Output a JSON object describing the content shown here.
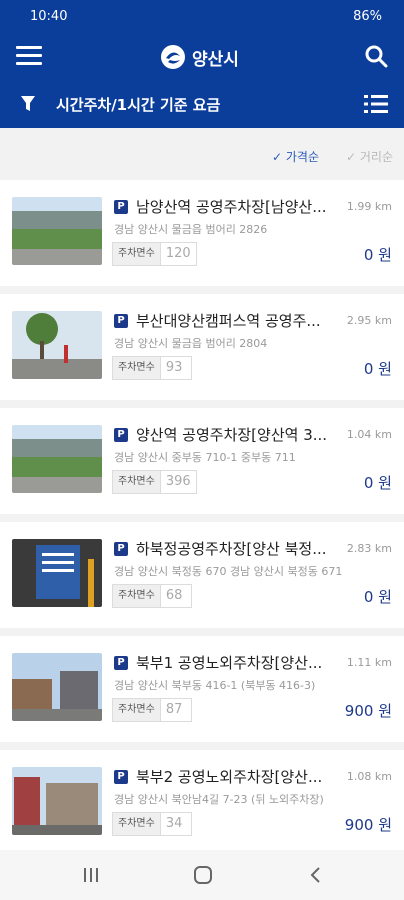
{
  "status": {
    "time": "10:40",
    "battery": "86%"
  },
  "app": {
    "title": "양산시"
  },
  "filter": {
    "label": "시간주차/1시간 기준 요금"
  },
  "sort": {
    "price": "✓ 가격순",
    "distance": "✓ 거리순"
  },
  "slots_label": "주차면수",
  "items": [
    {
      "name": "남양산역 공영주차장[남양산...",
      "distance": "1.99 km",
      "address": "경남 양산시 물금읍 범어리 2826",
      "slots": "120",
      "price": "0 원"
    },
    {
      "name": "부산대양산캠퍼스역 공영주...",
      "distance": "2.95 km",
      "address": "경남 양산시 물금읍 범어리 2804",
      "slots": "93",
      "price": "0 원"
    },
    {
      "name": "양산역 공영주차장[양산역 3...",
      "distance": "1.04 km",
      "address": "경남 양산시 중부동 710-1 중부동 711",
      "slots": "396",
      "price": "0 원"
    },
    {
      "name": "하북정공영주차장[양산 북정...",
      "distance": "2.83 km",
      "address": "경남 양산시 북정동 670 경남 양산시 북정동 671",
      "slots": "68",
      "price": "0 원"
    },
    {
      "name": "북부1 공영노외주차장[양산...",
      "distance": "1.11 km",
      "address": "경남 양산시 북부동 416-1 (북부동 416-3)",
      "slots": "87",
      "price": "900 원"
    },
    {
      "name": "북부2 공영노외주차장[양산...",
      "distance": "1.08 km",
      "address": "경남 양산시 북안남4길 7-23 (뒤 노외주차장)",
      "slots": "34",
      "price": "900 원"
    }
  ]
}
